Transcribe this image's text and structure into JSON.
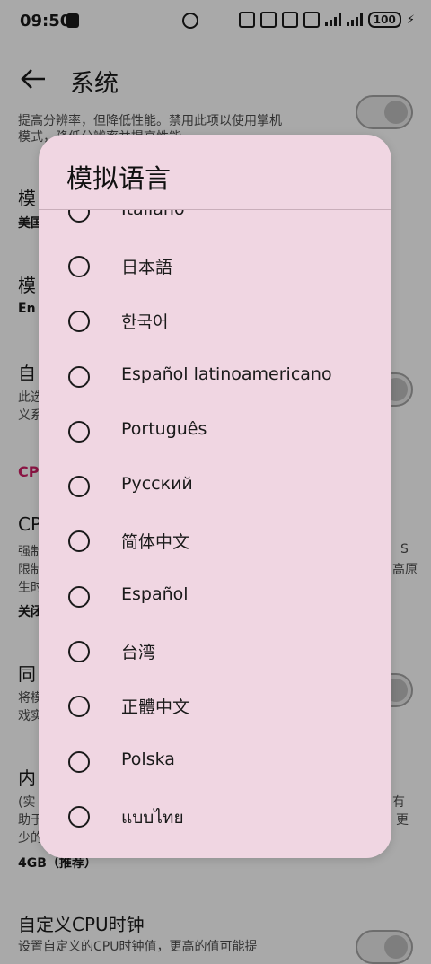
{
  "status_bar": {
    "time": "09:50",
    "battery": "100"
  },
  "app_bar": {
    "title": "系统"
  },
  "background": {
    "desc_top_1": "提高分辨率，但降低性能。禁用此项以使用掌机",
    "desc_top_2": "模式，降低分辨率并提高性能",
    "region_title": "模",
    "region_value": "美国",
    "lang_title": "模",
    "lang_value": "En",
    "custom_title": "自",
    "custom_desc_1": "此选",
    "custom_desc_2": "义系",
    "cpu_section": "CPU",
    "cpu_title": "CP",
    "cpu_desc_1": "强制",
    "cpu_desc_2": "限制",
    "cpu_desc_3": "生时",
    "cpu_desc_right_1": "S",
    "cpu_desc_right_2": "高原",
    "cpu_value": "关闭",
    "sync_title": "同",
    "sync_desc_1": "将模",
    "sync_desc_2": "戏实",
    "mem_title": "内",
    "mem_desc_1": "(实",
    "mem_desc_2": "助于",
    "mem_desc_3": "少的",
    "mem_desc_right_1": "有",
    "mem_desc_right_2": "更",
    "mem_value": "4GB（推荐）",
    "clock_title": "自定义CPU时钟",
    "clock_desc": "设置自定义的CPU时钟值，更高的值可能提"
  },
  "dialog": {
    "title": "模拟语言",
    "options": [
      {
        "label": "Italiano",
        "selected": false
      },
      {
        "label": "日本語",
        "selected": false
      },
      {
        "label": "한국어",
        "selected": false
      },
      {
        "label": "Español latinoamericano",
        "selected": false
      },
      {
        "label": "Português",
        "selected": false
      },
      {
        "label": "Русский",
        "selected": false
      },
      {
        "label": "简体中文",
        "selected": false
      },
      {
        "label": "Español",
        "selected": false
      },
      {
        "label": "台湾",
        "selected": false
      },
      {
        "label": "正體中文",
        "selected": false
      },
      {
        "label": "Polska",
        "selected": false
      },
      {
        "label": "แบบไทย",
        "selected": false
      }
    ]
  },
  "colors": {
    "scrim": "#a9a9a9",
    "dialog_bg": "#f0d6e2",
    "accent": "#8a1443"
  }
}
